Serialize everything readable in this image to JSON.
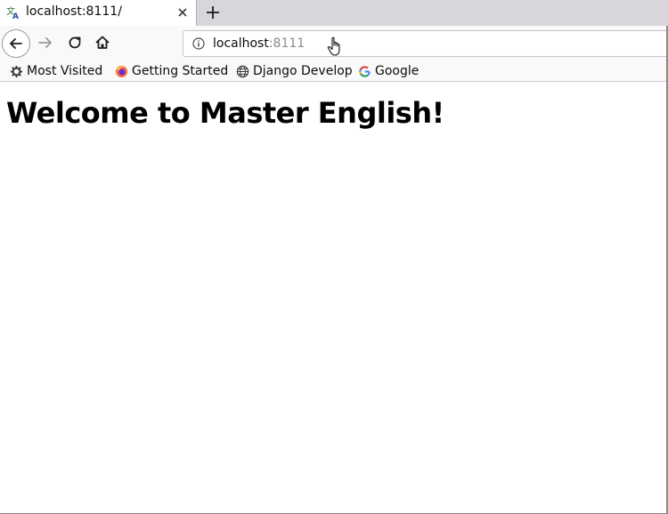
{
  "tab": {
    "title": "localhost:8111/",
    "favicon": "translate-icon"
  },
  "navbar": {
    "url_host": "localhost",
    "url_port": ":8111"
  },
  "bookmarks": [
    {
      "label": "Most Visited",
      "icon": "gear-icon"
    },
    {
      "label": "Getting Started",
      "icon": "firefox-icon"
    },
    {
      "label": "Django Develop",
      "icon": "globe-icon"
    },
    {
      "label": "Google",
      "icon": "google-icon"
    }
  ],
  "page": {
    "heading": "Welcome to Master English!"
  },
  "colors": {
    "tabstrip_bg": "#d7d7db",
    "toolbar_bg": "#f9f9fa",
    "page_bg": "#ffffff"
  }
}
